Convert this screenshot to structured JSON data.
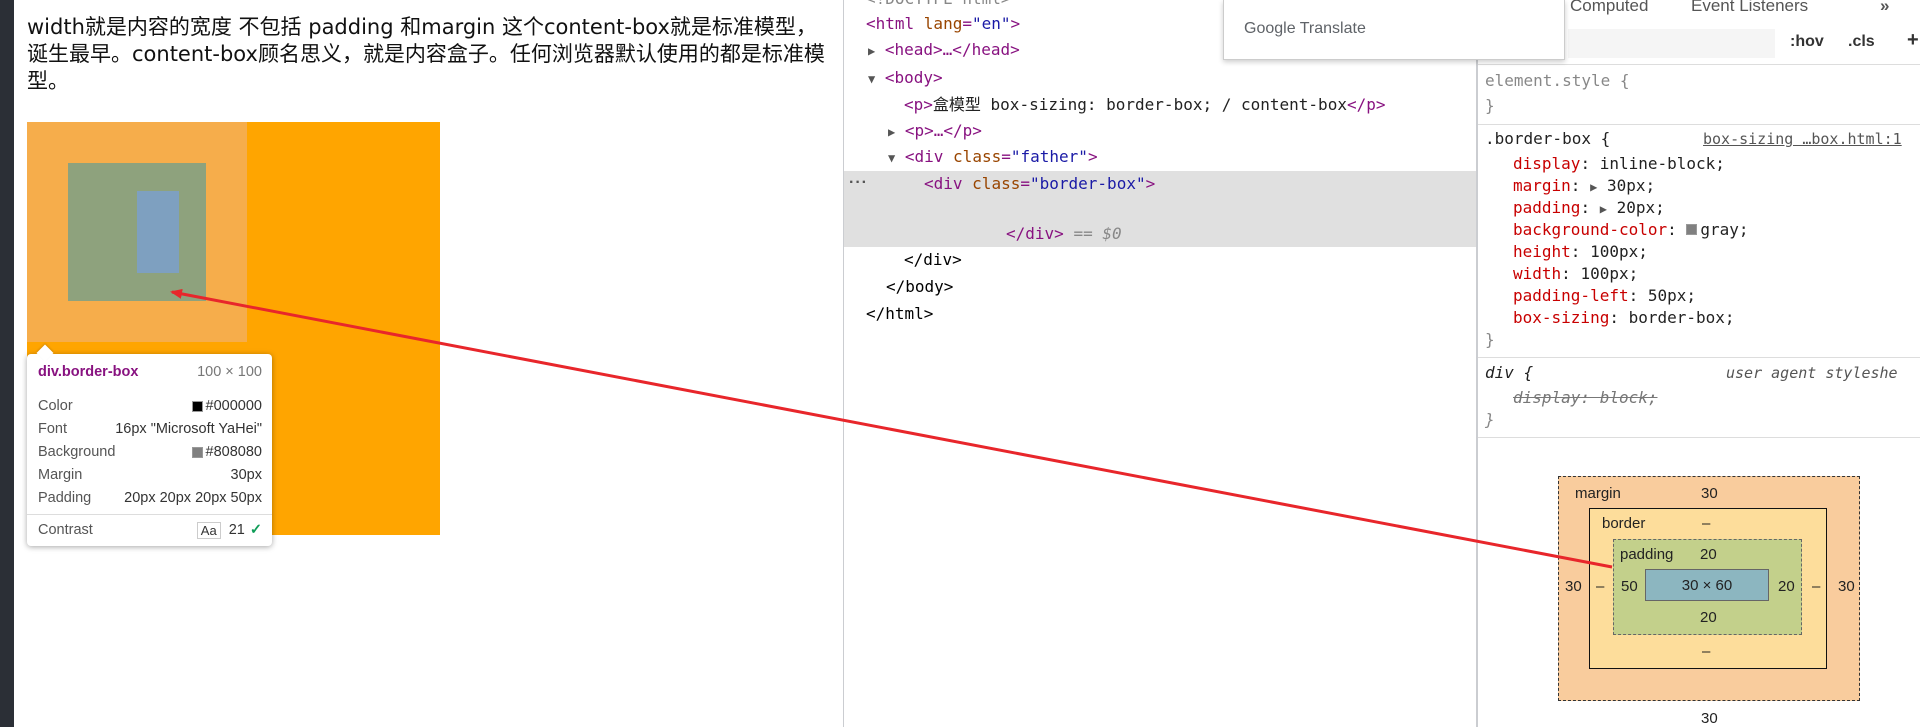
{
  "page": {
    "paragraph": "width就是内容的宽度 不包括 padding 和margin 这个content-box就是标准模型，诞生最早。content-box顾名思义，就是内容盒子。任何浏览器默认使用的都是标准模型。"
  },
  "tooltip": {
    "selector": "div.border-box",
    "dims": "100 × 100",
    "rows": [
      {
        "label": "Color",
        "value": "#000000",
        "swatch": "#000000"
      },
      {
        "label": "Font",
        "value": "16px \"Microsoft YaHei\""
      },
      {
        "label": "Background",
        "value": "#808080",
        "swatch": "#808080"
      },
      {
        "label": "Margin",
        "value": "30px"
      },
      {
        "label": "Padding",
        "value": "20px 20px 20px 50px"
      }
    ],
    "contrast_label": "Contrast",
    "contrast_aa": "Aa",
    "contrast_value": "21"
  },
  "elements": {
    "doctype": "<!DOCTYPE html>",
    "html_open": "<html lang=\"en\">",
    "head": "<head>…</head>",
    "body_open": "<body>",
    "p1_text": "盒模型 box-sizing: border-box; / content-box",
    "p2": "<p>…</p>",
    "div_father_class": "father",
    "div_border_class": "border-box",
    "div_close": "</div>",
    "selected_marker": "== $0",
    "div_father_close": "</div>",
    "body_close": "</body>",
    "html_close": "</html>",
    "dots": "···"
  },
  "translate_popup": {
    "label": "Google Translate"
  },
  "styles": {
    "tabs": [
      "Computed",
      "Event Listeners",
      "»"
    ],
    "hov_button": ":hov",
    "cls_button": ".cls",
    "add_button": "+",
    "element_style": "element.style {",
    "close_brace": "}",
    "rule_selector": ".border-box {",
    "rule_source": "box-sizing …box.html:1",
    "declarations": [
      {
        "name": "display",
        "value": "inline-block;"
      },
      {
        "name": "margin",
        "value": "30px;",
        "expand": true
      },
      {
        "name": "padding",
        "value": "20px;",
        "expand": true
      },
      {
        "name": "background-color",
        "value": "gray;",
        "swatch": "#808080"
      },
      {
        "name": "height",
        "value": "100px;"
      },
      {
        "name": "width",
        "value": "100px;"
      },
      {
        "name": "padding-left",
        "value": "50px;"
      },
      {
        "name": "box-sizing",
        "value": "border-box;"
      }
    ],
    "ua_selector": "div {",
    "ua_source": "user agent styleshe",
    "ua_declaration": "display: block;"
  },
  "box_model": {
    "margin_label": "margin",
    "margin_top": "30",
    "margin_bottom": "30",
    "margin_left": "30",
    "margin_right": "30",
    "border_label": "border",
    "border_top": "–",
    "border_bottom": "–",
    "border_left": "–",
    "border_right": "–",
    "padding_label": "padding",
    "padding_top": "20",
    "padding_bottom": "20",
    "padding_left": "50",
    "padding_right": "20",
    "content": "30 × 60"
  },
  "colors": {
    "father_bg": "#ffa500",
    "highlight_margin": "#f6ad4b",
    "highlight_padding": "#8ea27d",
    "highlight_content": "#7ea0c0",
    "arrow": "#e8262b",
    "tag": "#881280",
    "attr_name": "#994500",
    "attr_value": "#1a1aa6",
    "prop_name": "#c80000"
  }
}
